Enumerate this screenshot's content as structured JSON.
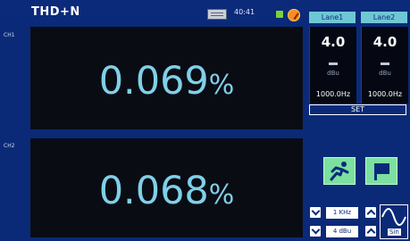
{
  "header": {
    "title": "THD+N",
    "time": "40:41"
  },
  "lanes": [
    {
      "tab": "Lane1",
      "value": "4.0",
      "unit": "dBu",
      "freq": "1000.0Hz"
    },
    {
      "tab": "Lane2",
      "value": "4.0",
      "unit": "dBu",
      "freq": "1000.0Hz"
    }
  ],
  "set_label": "SET",
  "channels": [
    {
      "label": "CH1",
      "value": "0.069",
      "unit": "%"
    },
    {
      "label": "CH2",
      "value": "0.068",
      "unit": "%"
    }
  ],
  "generator": {
    "frequency": "1 KHz",
    "level": "4 dBu",
    "waveform": "Sin"
  },
  "colors": {
    "background": "#0a2a78",
    "display_text": "#7fd0e8",
    "tab": "#6fc7d5",
    "status_green": "#7ad23a",
    "warning": "#ff8a1e"
  },
  "icons": [
    "clock-icon",
    "status-dot-icon",
    "warning-icon",
    "run-icon",
    "flag-icon",
    "sine-wave-icon"
  ]
}
